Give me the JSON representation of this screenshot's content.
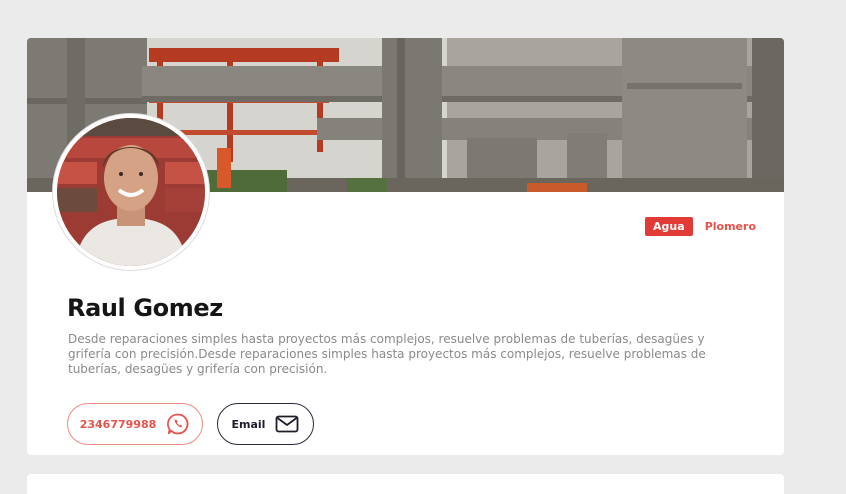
{
  "profile": {
    "name": "Raul Gomez",
    "description": "Desde reparaciones simples hasta proyectos más complejos, resuelve problemas de tuberías, desagües y grifería con precisión.Desde reparaciones simples hasta proyectos más complejos, resuelve problemas de tuberías, desagües y grifería con precisión.",
    "tags": {
      "primary": "Agua",
      "secondary": "Plomero"
    }
  },
  "actions": {
    "phone_label": "2346779988",
    "email_label": "Email"
  },
  "icons": {
    "phone": "whatsapp-icon",
    "email": "mail-icon"
  },
  "colors": {
    "accent": "#e23b35",
    "accent_light": "#e8524a",
    "background": "#ebebeb",
    "card": "#ffffff"
  }
}
